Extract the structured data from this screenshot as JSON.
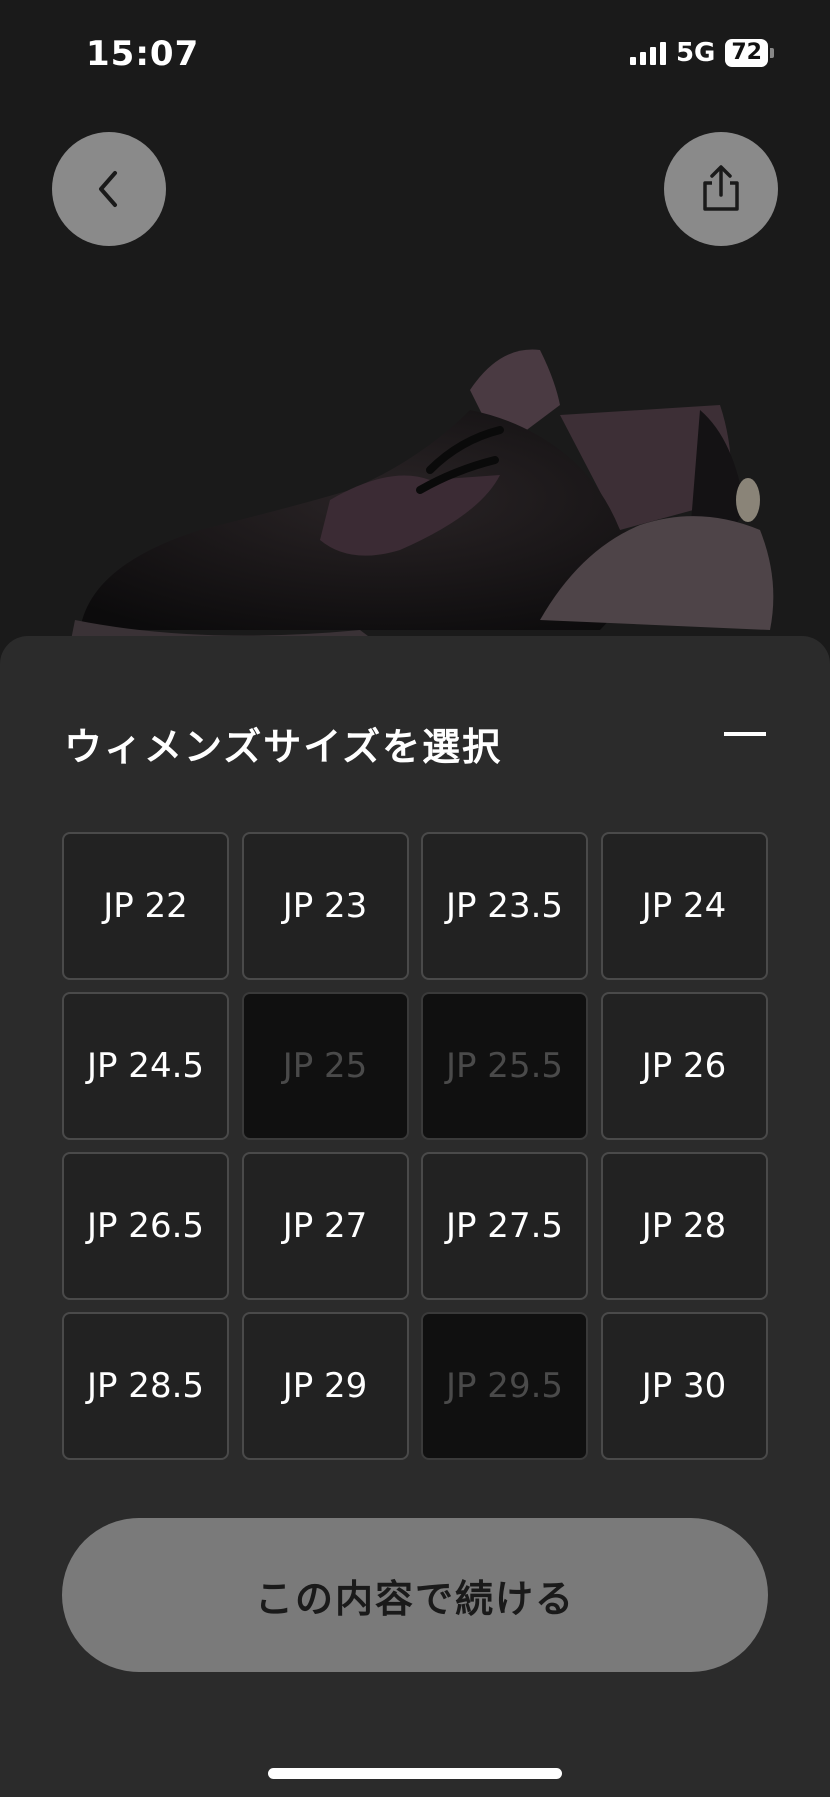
{
  "status": {
    "time": "15:07",
    "network": "5G",
    "battery": "72"
  },
  "header": {
    "back_icon": "chevron-left-icon",
    "share_icon": "share-icon"
  },
  "sheet": {
    "title": "ウィメンズサイズを選択",
    "collapse_icon": "minus-icon",
    "sizes": [
      {
        "label": "JP 22",
        "available": true
      },
      {
        "label": "JP 23",
        "available": true
      },
      {
        "label": "JP 23.5",
        "available": true
      },
      {
        "label": "JP 24",
        "available": true
      },
      {
        "label": "JP 24.5",
        "available": true
      },
      {
        "label": "JP 25",
        "available": false
      },
      {
        "label": "JP 25.5",
        "available": false
      },
      {
        "label": "JP 26",
        "available": true
      },
      {
        "label": "JP 26.5",
        "available": true
      },
      {
        "label": "JP 27",
        "available": true
      },
      {
        "label": "JP 27.5",
        "available": true
      },
      {
        "label": "JP 28",
        "available": true
      },
      {
        "label": "JP 28.5",
        "available": true
      },
      {
        "label": "JP 29",
        "available": true
      },
      {
        "label": "JP 29.5",
        "available": false
      },
      {
        "label": "JP 30",
        "available": true
      }
    ],
    "continue_label": "この内容で続ける"
  }
}
